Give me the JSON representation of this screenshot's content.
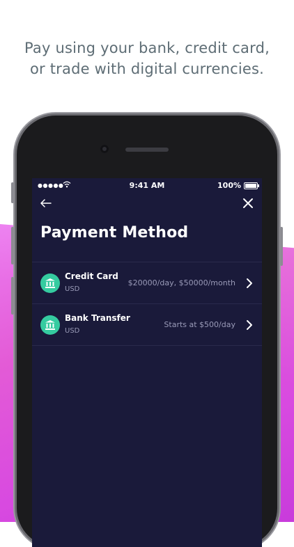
{
  "headline": {
    "line1": "Pay using your bank, credit card,",
    "line2": "or trade with digital currencies."
  },
  "status_bar": {
    "signal": "●●●●●",
    "time": "9:41 AM",
    "battery": "100%"
  },
  "page": {
    "title": "Payment Method"
  },
  "methods": [
    {
      "name": "Credit Card",
      "currency": "USD",
      "limit": "$20000/day, $50000/month",
      "icon": "bank-icon"
    },
    {
      "name": "Bank Transfer",
      "currency": "USD",
      "limit": "Starts at $500/day",
      "icon": "bank-icon"
    }
  ],
  "colors": {
    "screen_bg": "#1a1a3a",
    "icon_accent": "#35cba0",
    "headline_text": "#5e6d75",
    "gradient_pink": "#e35bd6"
  }
}
